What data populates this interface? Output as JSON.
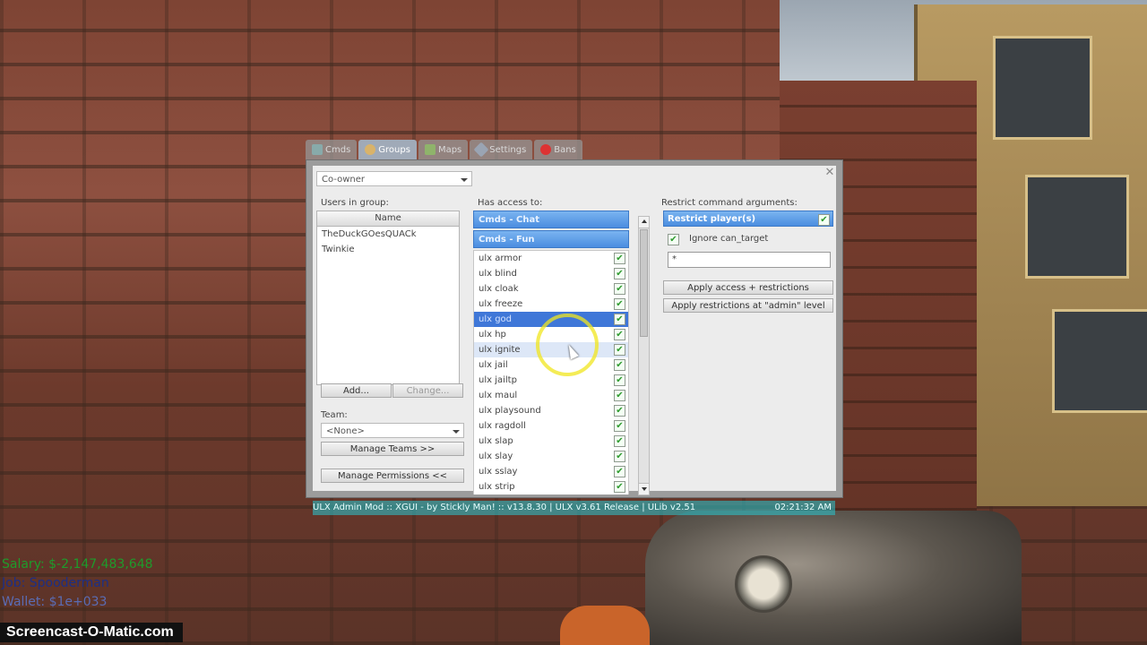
{
  "tabs": [
    {
      "label": "Cmds",
      "icon": "cmds-icon"
    },
    {
      "label": "Groups",
      "icon": "groups-icon"
    },
    {
      "label": "Maps",
      "icon": "maps-icon"
    },
    {
      "label": "Settings",
      "icon": "settings-icon"
    },
    {
      "label": "Bans",
      "icon": "bans-icon"
    }
  ],
  "window": {
    "close": "✕"
  },
  "group_select": {
    "value": "Co-owner"
  },
  "users": {
    "label": "Users in group:",
    "column": "Name",
    "rows": [
      "TheDuckGOesQUACk",
      "Twinkie"
    ],
    "add_label": "Add...",
    "change_label": "Change..."
  },
  "team": {
    "label": "Team:",
    "value": "<None>",
    "manage_teams": "Manage Teams >>",
    "manage_permissions": "Manage Permissions <<"
  },
  "access": {
    "label": "Has access to:",
    "categories": [
      "Cmds - Chat",
      "Cmds - Fun"
    ],
    "commands": [
      {
        "name": "ulx armor",
        "checked": true
      },
      {
        "name": "ulx blind",
        "checked": true
      },
      {
        "name": "ulx cloak",
        "checked": true
      },
      {
        "name": "ulx freeze",
        "checked": true
      },
      {
        "name": "ulx god",
        "checked": true
      },
      {
        "name": "ulx hp",
        "checked": true
      },
      {
        "name": "ulx ignite",
        "checked": true
      },
      {
        "name": "ulx jail",
        "checked": true
      },
      {
        "name": "ulx jailtp",
        "checked": true
      },
      {
        "name": "ulx maul",
        "checked": true
      },
      {
        "name": "ulx playsound",
        "checked": true
      },
      {
        "name": "ulx ragdoll",
        "checked": true
      },
      {
        "name": "ulx slap",
        "checked": true
      },
      {
        "name": "ulx slay",
        "checked": true
      },
      {
        "name": "ulx sslay",
        "checked": true
      },
      {
        "name": "ulx strip",
        "checked": true
      }
    ],
    "check_glyph": "✔"
  },
  "restrict": {
    "label": "Restrict command arguments:",
    "header": "Restrict player(s)",
    "ignore_label": "Ignore can_target",
    "value": "*",
    "apply_label": "Apply access + restrictions",
    "apply_admin_label": "Apply restrictions at \"admin\" level"
  },
  "statusbar": {
    "text": "ULX Admin Mod :: XGUI - by Stickly Man! :: v13.8.30  |  ULX v3.61 Release  |  ULib v2.51",
    "time": "02:21:32 AM"
  },
  "hud": {
    "salary": "Salary: $-2,147,483,648",
    "job": "Job: Spooderman",
    "wallet": "Wallet: $1e+033"
  },
  "watermark": "Screencast-O-Matic.com"
}
